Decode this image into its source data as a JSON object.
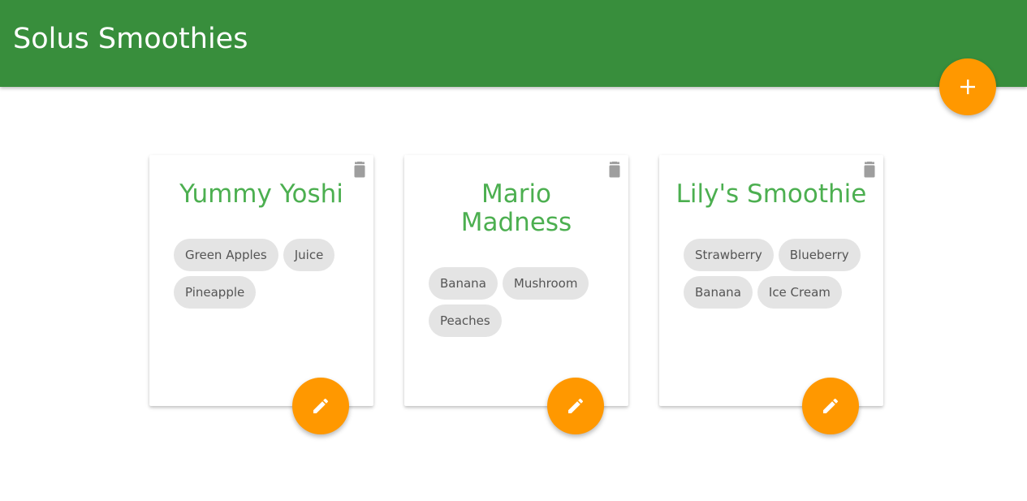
{
  "navbar": {
    "brand": "Solus Smoothies",
    "background_color": "#388e3c"
  },
  "add_button": {
    "icon": "plus-icon",
    "color": "#ff9800"
  },
  "smoothies": [
    {
      "title": "Yummy Yoshi",
      "ingredients": [
        "Green Apples",
        "Juice",
        "Pineapple"
      ]
    },
    {
      "title": "Mario Madness",
      "ingredients": [
        "Banana",
        "Mushroom",
        "Peaches"
      ]
    },
    {
      "title": "Lily's Smoothie",
      "ingredients": [
        "Strawberry",
        "Blueberry",
        "Banana",
        "Ice Cream"
      ]
    }
  ],
  "card_icons": {
    "delete": "trash-icon",
    "edit": "pencil-icon"
  },
  "colors": {
    "title": "#4caf50",
    "accent": "#ff9800",
    "chip_bg": "#e4e4e4",
    "chip_text": "#555555",
    "trash": "#9e9e9e"
  }
}
